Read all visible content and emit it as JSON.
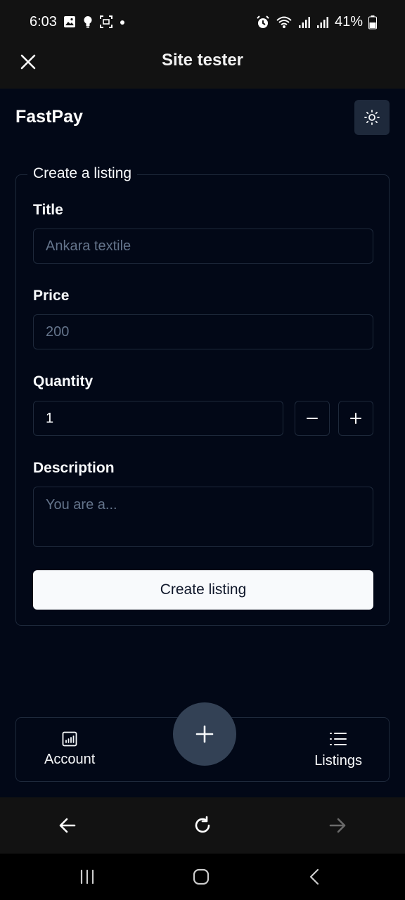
{
  "status_bar": {
    "time": "6:03",
    "battery": "41%",
    "left_icons": [
      "image-icon",
      "bulb-icon",
      "screenshot-icon",
      "dot-icon"
    ],
    "right_icons": [
      "alarm-icon",
      "wifi-icon",
      "signal-icon",
      "signal-icon",
      "battery-icon"
    ]
  },
  "topbar": {
    "title": "Site tester",
    "close_icon": "close-icon"
  },
  "header": {
    "brand": "FastPay",
    "theme_icon": "sun-icon"
  },
  "form": {
    "legend": "Create a listing",
    "title_label": "Title",
    "title_placeholder": "Ankara textile",
    "price_label": "Price",
    "price_placeholder": "200",
    "quantity_label": "Quantity",
    "quantity_value": "1",
    "description_label": "Description",
    "description_placeholder": "You are a...",
    "submit_label": "Create listing"
  },
  "bottom_nav": {
    "account_label": "Account",
    "listings_label": "Listings",
    "account_icon": "chart-icon",
    "listings_icon": "list-icon",
    "fab_icon": "plus-icon"
  },
  "browser_bar": {
    "icons": [
      "arrow-left-icon",
      "refresh-icon",
      "arrow-right-icon"
    ]
  },
  "system_nav": {
    "icons": [
      "recents-icon",
      "home-icon",
      "back-icon"
    ]
  },
  "colors": {
    "background": "#020817",
    "border": "#1e293b",
    "accent_button": "#f8fafc",
    "fab": "#334155",
    "chrome": "#121212"
  }
}
